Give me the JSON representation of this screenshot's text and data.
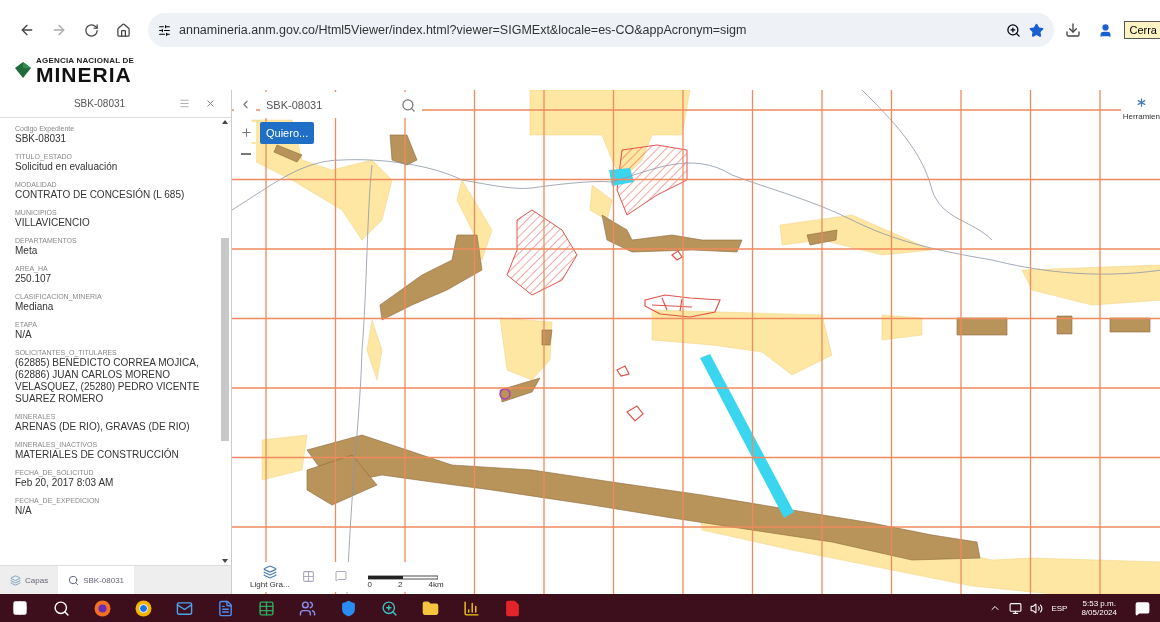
{
  "browser": {
    "url": "annamineria.anm.gov.co/Html5Viewer/index.html?viewer=SIGMExt&locale=es-CO&appAcronym=sigm",
    "profile_button": "Cerra"
  },
  "header": {
    "agency": "AGENCIA NACIONAL DE",
    "name": "MINERIA"
  },
  "panel": {
    "title": "SBK-08031",
    "fields": [
      {
        "label": "Codigo Expediente",
        "value": "SBK-08031"
      },
      {
        "label": "TITULO_ESTADO",
        "value": "Solicitud en evaluación"
      },
      {
        "label": "MODALIDAD",
        "value": "CONTRATO DE CONCESIÓN (L 685)"
      },
      {
        "label": "MUNICIPIOS",
        "value": "VILLAVICENCIO"
      },
      {
        "label": "DEPARTAMENTOS",
        "value": "Meta"
      },
      {
        "label": "AREA_HA",
        "value": "250.107"
      },
      {
        "label": "CLASIFICACION_MINERIA",
        "value": "Mediana"
      },
      {
        "label": "ETAPA",
        "value": "N/A"
      },
      {
        "label": "SOLICITANTES_O_TITULARES",
        "value": "(62885) BENEDICTO CORREA MOJICA, (62886) JUAN CARLOS MORENO VELASQUEZ, (25280) PEDRO VICENTE SUAREZ ROMERO"
      },
      {
        "label": "MINERALES",
        "value": "ARENAS (DE RIO), GRAVAS (DE RIO)"
      },
      {
        "label": "MINERALES_INACTIVOS",
        "value": "MATERIALES DE CONSTRUCCIÓN"
      },
      {
        "label": "FECHA_DE_SOLICITUD",
        "value": "Feb 20, 2017 8:03 AM"
      },
      {
        "label": "FECHA_DE_EXPEDICION",
        "value": "N/A"
      }
    ],
    "tabs": [
      {
        "label": "Capas",
        "selected": false
      },
      {
        "label": "SBK-08031",
        "selected": true
      }
    ]
  },
  "map": {
    "search": {
      "value": "SBK-08031"
    },
    "quiero_button": "Quiero...",
    "tools_label": "Herramien",
    "basemap_label": "Light Gra...",
    "scale_labels": [
      "0",
      "2",
      "4km"
    ]
  },
  "taskbar": {
    "language": "ESP",
    "time": "5:53 p.m.",
    "date": "8/05/2024"
  }
}
